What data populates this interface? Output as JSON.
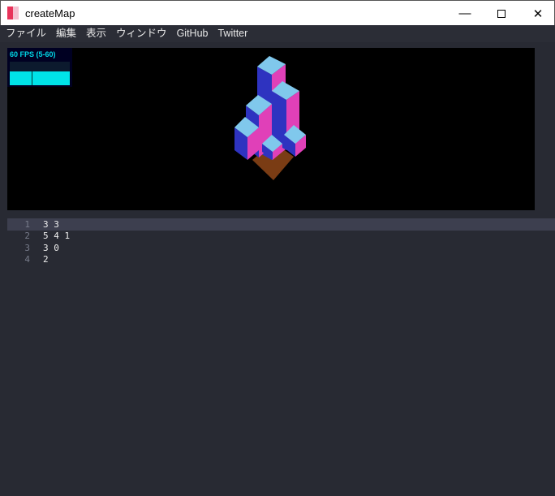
{
  "window": {
    "title": "createMap",
    "minimize_icon": "minimize-icon",
    "maximize_icon": "maximize-icon",
    "close_icon": "close-icon"
  },
  "menu": [
    "ファイル",
    "編集",
    "表示",
    "ウィンドウ",
    "GitHub",
    "Twitter"
  ],
  "stats": {
    "fps_label": "60 FPS (5-60)",
    "fps": 60,
    "fps_min": 5,
    "fps_max": 60
  },
  "scene": {
    "colors": {
      "top": "#80c8ec",
      "left": "#2e33c0",
      "right": "#e040b8",
      "ground": "#7a3c14"
    },
    "heights": [
      [
        3,
        3
      ],
      [
        5,
        4,
        1
      ],
      [
        3,
        0
      ],
      [
        2
      ]
    ]
  },
  "editor": {
    "lines": [
      {
        "n": "1",
        "text": "3 3"
      },
      {
        "n": "2",
        "text": "5 4 1"
      },
      {
        "n": "3",
        "text": "3 0"
      },
      {
        "n": "4",
        "text": "2"
      }
    ]
  }
}
